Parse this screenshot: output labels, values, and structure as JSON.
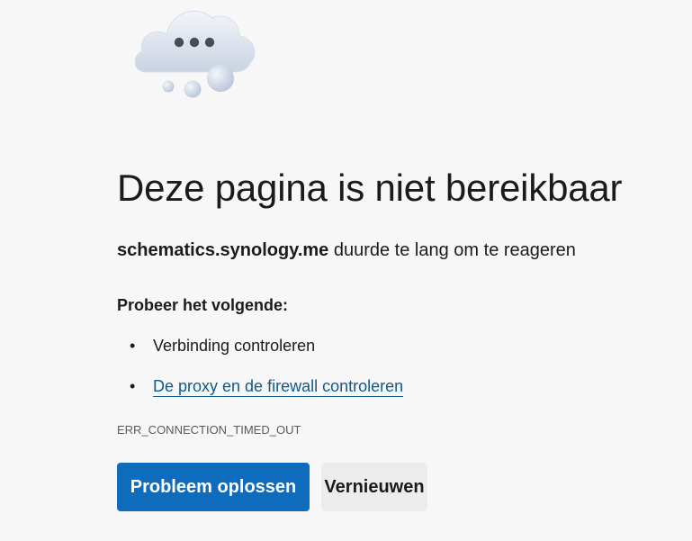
{
  "error_page": {
    "title": "Deze pagina is niet bereikbaar",
    "host": "schematics.synology.me",
    "description_suffix": " duurde te lang om te reageren",
    "suggestions_heading": "Probeer het volgende:",
    "suggestions": [
      {
        "label": "Verbinding controleren",
        "is_link": false
      },
      {
        "label": "De proxy en de firewall controleren",
        "is_link": true
      }
    ],
    "error_code": "ERR_CONNECTION_TIMED_OUT",
    "buttons": {
      "troubleshoot_label": "Probleem oplossen",
      "refresh_label": "Vernieuwen"
    }
  },
  "icons": {
    "illustration": "cloud-thinking-icon",
    "bullet": "bullet-dot-icon"
  },
  "colors": {
    "background": "#f7f7f7",
    "primary_button": "#0f6cbd",
    "secondary_button": "#ececec",
    "link": "#0e5a8e",
    "text": "#1b1b1b"
  }
}
